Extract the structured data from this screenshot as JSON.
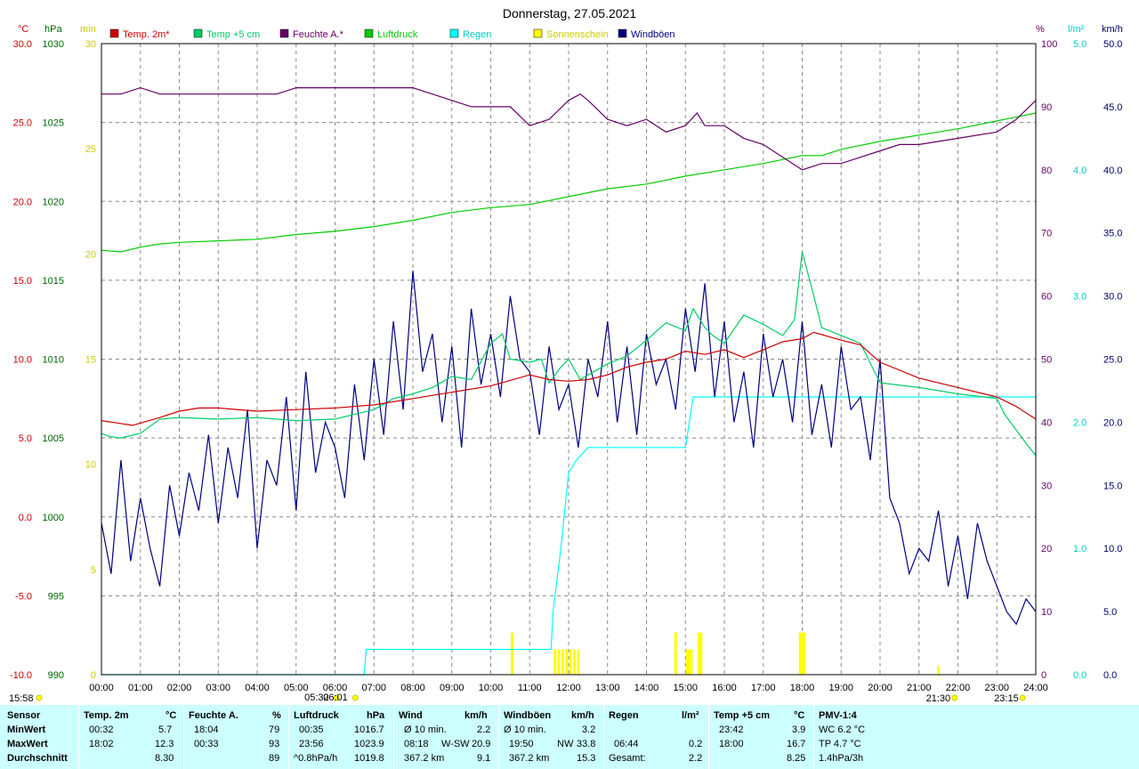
{
  "chart_data": {
    "type": "line",
    "title": "Donnerstag, 27.05.2021",
    "x_ticks": [
      "00:00",
      "01:00",
      "02:00",
      "03:00",
      "04:00",
      "05:00",
      "06:00",
      "07:00",
      "08:00",
      "09:00",
      "10:00",
      "11:00",
      "12:00",
      "13:00",
      "14:00",
      "15:00",
      "16:00",
      "17:00",
      "18:00",
      "19:00",
      "20:00",
      "21:00",
      "22:00",
      "23:00",
      "24:00"
    ],
    "xlim": [
      0,
      24
    ],
    "grid": true,
    "legend_position": "top",
    "axes": {
      "temp": {
        "unit": "°C",
        "range": [
          -10,
          30
        ],
        "ticks": [
          "30.0",
          "25.0",
          "20.0",
          "15.0",
          "10.0",
          "5.0",
          "0.0",
          "-5.0",
          "-10.0"
        ],
        "color": "#cc0000"
      },
      "pressure": {
        "unit": "hPa",
        "range": [
          990,
          1030
        ],
        "ticks": [
          "1030",
          "1025",
          "1020",
          "1015",
          "1010",
          "1005",
          "1000",
          "995",
          "990"
        ],
        "color": "#006600"
      },
      "sun": {
        "unit": "min",
        "range": [
          0,
          30
        ],
        "ticks": [
          "30",
          "25",
          "20",
          "15",
          "10",
          "5",
          "0"
        ],
        "color": "#cccc00"
      },
      "humidity": {
        "unit": "%",
        "range": [
          0,
          100
        ],
        "ticks": [
          "100",
          "90",
          "80",
          "70",
          "60",
          "50",
          "40",
          "30",
          "20",
          "10",
          "0"
        ],
        "color": "#660066"
      },
      "rain": {
        "unit": "l/m²",
        "range": [
          0,
          5
        ],
        "ticks": [
          "5.0",
          "4.0",
          "3.0",
          "2.0",
          "1.0",
          "0.0"
        ],
        "color": "#00cccc"
      },
      "wind": {
        "unit": "km/h",
        "range": [
          0,
          50
        ],
        "ticks": [
          "50.0",
          "45.0",
          "40.0",
          "35.0",
          "30.0",
          "25.0",
          "20.0",
          "15.0",
          "10.0",
          "5.0",
          "0.0"
        ],
        "color": "#000066"
      }
    },
    "legend": [
      {
        "name": "Temp. 2m*",
        "color": "#cc0000"
      },
      {
        "name": "Temp +5 cm",
        "color": "#00cc66"
      },
      {
        "name": "Feuchte A.*",
        "color": "#660066"
      },
      {
        "name": "Luftdruck",
        "color": "#00cc00"
      },
      {
        "name": "Regen",
        "color": "#00ffff"
      },
      {
        "name": "Sonnenschein",
        "color": "#ffff00"
      },
      {
        "name": "Windböen",
        "color": "#000080"
      }
    ],
    "series": {
      "temp2m": {
        "axis": "temp",
        "x": [
          0,
          0.8,
          1.5,
          2,
          2.5,
          3,
          4,
          5,
          6,
          7,
          8,
          9,
          10,
          11,
          11.5,
          12,
          12.5,
          13,
          13.5,
          14,
          14.5,
          15,
          15.5,
          16,
          16.5,
          17,
          17.5,
          18,
          18.3,
          19,
          19.5,
          20,
          21,
          22,
          23,
          23.5,
          24
        ],
        "y": [
          6.1,
          5.8,
          6.3,
          6.7,
          6.9,
          6.9,
          6.7,
          6.8,
          6.9,
          7.1,
          7.5,
          7.9,
          8.3,
          9.0,
          8.7,
          8.6,
          8.7,
          9.0,
          9.5,
          9.8,
          10.0,
          10.5,
          10.3,
          10.6,
          10.1,
          10.6,
          11.1,
          11.3,
          11.7,
          11.2,
          10.9,
          9.8,
          8.8,
          8.2,
          7.6,
          7.0,
          6.2
        ]
      },
      "temp5cm": {
        "axis": "temp",
        "x": [
          0,
          0.2,
          0.5,
          1,
          1.5,
          2,
          3,
          4,
          5,
          6,
          7,
          7.5,
          8,
          8.5,
          9,
          9.5,
          10,
          10.3,
          10.5,
          11,
          11.3,
          11.5,
          11.8,
          12,
          12.3,
          12.5,
          13,
          13.5,
          14,
          14.5,
          15,
          15.2,
          15.5,
          15.7,
          16,
          16.5,
          17,
          17.5,
          17.8,
          18,
          18.3,
          18.5,
          19,
          19.5,
          20,
          21,
          22,
          23,
          23.2,
          23.5,
          23.8,
          24
        ],
        "y": [
          5.3,
          5.1,
          5.0,
          5.3,
          6.2,
          6.3,
          6.2,
          6.3,
          6.1,
          6.2,
          6.8,
          7.5,
          7.8,
          8.2,
          8.9,
          8.7,
          11.0,
          11.6,
          10.0,
          9.8,
          10.0,
          8.5,
          9.5,
          10.0,
          8.7,
          9.0,
          9.7,
          10.2,
          11.2,
          12.3,
          11.8,
          13.2,
          12.0,
          11.5,
          11.0,
          12.8,
          12.2,
          11.5,
          12.5,
          16.8,
          14.0,
          12.0,
          11.5,
          11.0,
          8.5,
          8.2,
          7.8,
          7.5,
          6.5,
          5.5,
          4.5,
          3.9
        ]
      },
      "humidity": {
        "axis": "humidity",
        "x": [
          0,
          0.5,
          1,
          1.5,
          2,
          2.5,
          3,
          4,
          4.5,
          5,
          6,
          7,
          7.5,
          8,
          8.5,
          9,
          9.5,
          10,
          10.5,
          11,
          11.5,
          12,
          12.3,
          12.5,
          13,
          13.5,
          14,
          14.5,
          15,
          15.3,
          15.5,
          16,
          16.5,
          17,
          17.5,
          18,
          18.5,
          19,
          19.5,
          20,
          20.5,
          21,
          22,
          23,
          23.5,
          24
        ],
        "y": [
          92,
          92,
          93,
          92,
          92,
          92,
          92,
          92,
          92,
          93,
          93,
          93,
          93,
          93,
          92,
          91,
          90,
          90,
          90,
          87,
          88,
          91,
          92,
          91,
          88,
          87,
          88,
          86,
          87,
          89,
          87,
          87,
          85,
          84,
          82,
          80,
          81,
          81,
          82,
          83,
          84,
          84,
          85,
          86,
          88,
          91
        ]
      },
      "pressure": {
        "axis": "pressure",
        "x": [
          0,
          0.5,
          1,
          1.5,
          2,
          3,
          4,
          5,
          6,
          7,
          8,
          9,
          10,
          11,
          12,
          13,
          14,
          15,
          16,
          17,
          18,
          18.5,
          19,
          20,
          21,
          22,
          23,
          24
        ],
        "y": [
          1016.9,
          1016.8,
          1017.1,
          1017.3,
          1017.4,
          1017.5,
          1017.6,
          1017.9,
          1018.1,
          1018.4,
          1018.8,
          1019.3,
          1019.6,
          1019.8,
          1020.3,
          1020.8,
          1021.1,
          1021.6,
          1022.0,
          1022.4,
          1022.9,
          1022.9,
          1023.3,
          1023.8,
          1024.2,
          1024.6,
          1025.1,
          1025.6
        ]
      },
      "rain": {
        "axis": "rain",
        "x": [
          0,
          6.75,
          6.8,
          11.55,
          11.6,
          11.8,
          12,
          12.2,
          12.5,
          13,
          14,
          15,
          15.2,
          16,
          18,
          20,
          22,
          24
        ],
        "y": [
          0,
          0,
          0.2,
          0.2,
          0.5,
          1.0,
          1.6,
          1.7,
          1.8,
          1.8,
          1.8,
          1.8,
          2.2,
          2.2,
          2.2,
          2.2,
          2.2,
          2.2
        ]
      },
      "sunshine": {
        "axis": "sun",
        "x": [
          10.55,
          11.65,
          11.75,
          11.85,
          11.95,
          12.05,
          12.15,
          12.25,
          14.75,
          15.05,
          15.1,
          15.15,
          15.35,
          15.4,
          17.95,
          18.0,
          18.05,
          21.5
        ],
        "y": [
          2,
          1.2,
          1.2,
          1.2,
          1.2,
          1.2,
          1.2,
          1.2,
          2,
          1.2,
          1.2,
          1.2,
          2,
          2,
          2,
          2,
          2,
          0.4
        ]
      },
      "gusts": {
        "axis": "wind",
        "x": [
          0,
          0.25,
          0.5,
          0.75,
          1,
          1.25,
          1.5,
          1.75,
          2,
          2.25,
          2.5,
          2.75,
          3,
          3.25,
          3.5,
          3.75,
          4,
          4.25,
          4.5,
          4.75,
          5,
          5.25,
          5.5,
          5.75,
          6,
          6.25,
          6.5,
          6.75,
          7,
          7.25,
          7.5,
          7.75,
          8,
          8.25,
          8.5,
          8.75,
          9,
          9.25,
          9.5,
          9.75,
          10,
          10.25,
          10.5,
          10.75,
          11,
          11.25,
          11.5,
          11.75,
          12,
          12.25,
          12.5,
          12.75,
          13,
          13.25,
          13.5,
          13.75,
          14,
          14.25,
          14.5,
          14.75,
          15,
          15.25,
          15.5,
          15.75,
          16,
          16.25,
          16.5,
          16.75,
          17,
          17.25,
          17.5,
          17.75,
          18,
          18.25,
          18.5,
          18.75,
          19,
          19.25,
          19.5,
          19.75,
          20,
          20.25,
          20.5,
          20.75,
          21,
          21.25,
          21.5,
          21.75,
          22,
          22.25,
          22.5,
          22.75,
          23,
          23.25,
          23.5,
          23.75,
          24
        ],
        "y": [
          12,
          8,
          17,
          9,
          14,
          10,
          7,
          15,
          11,
          16,
          13,
          19,
          12,
          18,
          14,
          21,
          10,
          17,
          15,
          22,
          13,
          24,
          16,
          20,
          18,
          14,
          23,
          17,
          25,
          19,
          28,
          21,
          32,
          24,
          27,
          20,
          26,
          18,
          29,
          23,
          27,
          22,
          30,
          25,
          24,
          19,
          26,
          21,
          23,
          18,
          25,
          22,
          28,
          20,
          26,
          19,
          27,
          23,
          25,
          21,
          29,
          24,
          31,
          22,
          28,
          20,
          24,
          18,
          27,
          22,
          25,
          20,
          28,
          19,
          23,
          18,
          26,
          21,
          22,
          17,
          25,
          14,
          12,
          8,
          10,
          9,
          13,
          7,
          11,
          6,
          12,
          9,
          7,
          5,
          4,
          6,
          5,
          6,
          5
        ]
      }
    },
    "date_markers": [
      {
        "label": "15:58",
        "time": "00:00",
        "pos": "bottom-left"
      },
      {
        "label": "05:32",
        "time": "05:32",
        "pos": "bottom"
      },
      {
        "label": "06:01",
        "time": "06:01",
        "pos": "bottom"
      },
      {
        "label": "21:30",
        "time": "21:30",
        "pos": "bottom"
      },
      {
        "label": "23:15",
        "time": "23:15",
        "pos": "bottom"
      }
    ]
  },
  "stats": {
    "row_labels": {
      "sensor": "Sensor",
      "min": "MinWert",
      "max": "MaxWert",
      "avg": "Durchschnitt"
    },
    "temp2m": {
      "title": "Temp. 2m",
      "unit": "°C",
      "min_time": "00:32",
      "min_val": "5.7",
      "max_time": "18:02",
      "max_val": "12.3",
      "avg_val": "8.30"
    },
    "humidity": {
      "title": "Feuchte A.",
      "unit": "%",
      "min_time": "18:04",
      "min_val": "79",
      "max_time": "00:33",
      "max_val": "93",
      "avg_val": "89"
    },
    "pressure": {
      "title": "Luftdruck",
      "unit": "hPa",
      "min_time": "00:35",
      "min_val": "1016.7",
      "max_time": "23:56",
      "max_val": "1023.9",
      "avg_label": "^0.8hPa/h",
      "avg_val": "1019.8"
    },
    "wind": {
      "title": "Wind",
      "unit": "km/h",
      "min_time": "Ø 10 min.",
      "min_val": "2.2",
      "max_time": "08:18",
      "max_dir": "W-SW",
      "max_val": "20.9",
      "avg_label": "367.2 km",
      "avg_val": "9.1"
    },
    "gusts": {
      "title": "Windböen",
      "unit": "km/h",
      "min_time": "Ø 10 min.",
      "min_val": "3.2",
      "max_time": "19:50",
      "max_dir": "NW",
      "max_val": "33.8",
      "avg_label": "367.2 km",
      "avg_val": "15.3"
    },
    "rain": {
      "title": "Regen",
      "unit": "l/m²",
      "max_time": "06:44",
      "max_val": "0.2",
      "avg_label": "Gesamt:",
      "avg_val": "2.2"
    },
    "temp5cm": {
      "title": "Temp +5 cm",
      "unit": "°C",
      "min_time": "23:42",
      "min_val": "3.9",
      "max_time": "18:00",
      "max_val": "16.7",
      "avg_val": "8.25"
    },
    "pmv": {
      "title": "PMV-1:4",
      "min_text": "WC 6.2 °C",
      "max_text": "TP 4.7 °C",
      "avg_text": "1.4hPa/3h"
    }
  }
}
